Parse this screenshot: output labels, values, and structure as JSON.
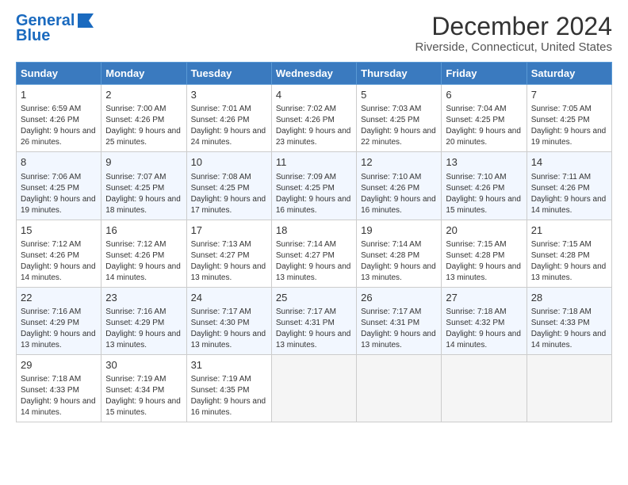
{
  "header": {
    "logo_line1": "General",
    "logo_line2": "Blue",
    "month_title": "December 2024",
    "location": "Riverside, Connecticut, United States"
  },
  "days_of_week": [
    "Sunday",
    "Monday",
    "Tuesday",
    "Wednesday",
    "Thursday",
    "Friday",
    "Saturday"
  ],
  "weeks": [
    [
      {
        "day": "1",
        "sunrise": "6:59 AM",
        "sunset": "4:26 PM",
        "daylight": "9 hours and 26 minutes."
      },
      {
        "day": "2",
        "sunrise": "7:00 AM",
        "sunset": "4:26 PM",
        "daylight": "9 hours and 25 minutes."
      },
      {
        "day": "3",
        "sunrise": "7:01 AM",
        "sunset": "4:26 PM",
        "daylight": "9 hours and 24 minutes."
      },
      {
        "day": "4",
        "sunrise": "7:02 AM",
        "sunset": "4:26 PM",
        "daylight": "9 hours and 23 minutes."
      },
      {
        "day": "5",
        "sunrise": "7:03 AM",
        "sunset": "4:25 PM",
        "daylight": "9 hours and 22 minutes."
      },
      {
        "day": "6",
        "sunrise": "7:04 AM",
        "sunset": "4:25 PM",
        "daylight": "9 hours and 20 minutes."
      },
      {
        "day": "7",
        "sunrise": "7:05 AM",
        "sunset": "4:25 PM",
        "daylight": "9 hours and 19 minutes."
      }
    ],
    [
      {
        "day": "8",
        "sunrise": "7:06 AM",
        "sunset": "4:25 PM",
        "daylight": "9 hours and 19 minutes."
      },
      {
        "day": "9",
        "sunrise": "7:07 AM",
        "sunset": "4:25 PM",
        "daylight": "9 hours and 18 minutes."
      },
      {
        "day": "10",
        "sunrise": "7:08 AM",
        "sunset": "4:25 PM",
        "daylight": "9 hours and 17 minutes."
      },
      {
        "day": "11",
        "sunrise": "7:09 AM",
        "sunset": "4:25 PM",
        "daylight": "9 hours and 16 minutes."
      },
      {
        "day": "12",
        "sunrise": "7:10 AM",
        "sunset": "4:26 PM",
        "daylight": "9 hours and 16 minutes."
      },
      {
        "day": "13",
        "sunrise": "7:10 AM",
        "sunset": "4:26 PM",
        "daylight": "9 hours and 15 minutes."
      },
      {
        "day": "14",
        "sunrise": "7:11 AM",
        "sunset": "4:26 PM",
        "daylight": "9 hours and 14 minutes."
      }
    ],
    [
      {
        "day": "15",
        "sunrise": "7:12 AM",
        "sunset": "4:26 PM",
        "daylight": "9 hours and 14 minutes."
      },
      {
        "day": "16",
        "sunrise": "7:12 AM",
        "sunset": "4:26 PM",
        "daylight": "9 hours and 14 minutes."
      },
      {
        "day": "17",
        "sunrise": "7:13 AM",
        "sunset": "4:27 PM",
        "daylight": "9 hours and 13 minutes."
      },
      {
        "day": "18",
        "sunrise": "7:14 AM",
        "sunset": "4:27 PM",
        "daylight": "9 hours and 13 minutes."
      },
      {
        "day": "19",
        "sunrise": "7:14 AM",
        "sunset": "4:28 PM",
        "daylight": "9 hours and 13 minutes."
      },
      {
        "day": "20",
        "sunrise": "7:15 AM",
        "sunset": "4:28 PM",
        "daylight": "9 hours and 13 minutes."
      },
      {
        "day": "21",
        "sunrise": "7:15 AM",
        "sunset": "4:28 PM",
        "daylight": "9 hours and 13 minutes."
      }
    ],
    [
      {
        "day": "22",
        "sunrise": "7:16 AM",
        "sunset": "4:29 PM",
        "daylight": "9 hours and 13 minutes."
      },
      {
        "day": "23",
        "sunrise": "7:16 AM",
        "sunset": "4:29 PM",
        "daylight": "9 hours and 13 minutes."
      },
      {
        "day": "24",
        "sunrise": "7:17 AM",
        "sunset": "4:30 PM",
        "daylight": "9 hours and 13 minutes."
      },
      {
        "day": "25",
        "sunrise": "7:17 AM",
        "sunset": "4:31 PM",
        "daylight": "9 hours and 13 minutes."
      },
      {
        "day": "26",
        "sunrise": "7:17 AM",
        "sunset": "4:31 PM",
        "daylight": "9 hours and 13 minutes."
      },
      {
        "day": "27",
        "sunrise": "7:18 AM",
        "sunset": "4:32 PM",
        "daylight": "9 hours and 14 minutes."
      },
      {
        "day": "28",
        "sunrise": "7:18 AM",
        "sunset": "4:33 PM",
        "daylight": "9 hours and 14 minutes."
      }
    ],
    [
      {
        "day": "29",
        "sunrise": "7:18 AM",
        "sunset": "4:33 PM",
        "daylight": "9 hours and 14 minutes."
      },
      {
        "day": "30",
        "sunrise": "7:19 AM",
        "sunset": "4:34 PM",
        "daylight": "9 hours and 15 minutes."
      },
      {
        "day": "31",
        "sunrise": "7:19 AM",
        "sunset": "4:35 PM",
        "daylight": "9 hours and 16 minutes."
      },
      null,
      null,
      null,
      null
    ]
  ],
  "labels": {
    "sunrise": "Sunrise:",
    "sunset": "Sunset:",
    "daylight": "Daylight:"
  }
}
